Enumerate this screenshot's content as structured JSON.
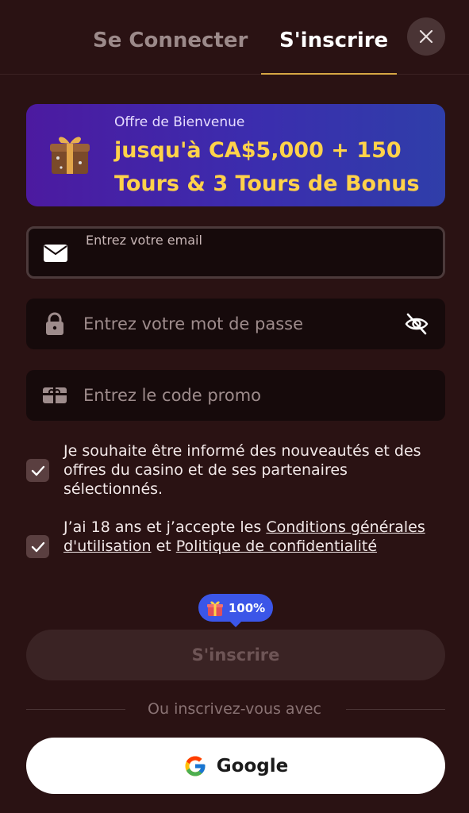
{
  "tabs": {
    "login": "Se Connecter",
    "signup": "S'inscrire"
  },
  "banner": {
    "subtitle": "Offre de Bienvenue",
    "title": "jusqu'à CA$5,000 + 150 Tours & 3 Tours de Bonus"
  },
  "form": {
    "email_label": "Entrez votre email",
    "email_value": "",
    "password_placeholder": "Entrez votre mot de passe",
    "promo_placeholder": "Entrez le code promo"
  },
  "consent": {
    "newsletter": "Je souhaite être informé des nouveautés et des offres du casino et de ses partenaires sélectionnés.",
    "age_prefix": "J’ai 18 ans et j’accepte les ",
    "terms_link": "Conditions générales d'utilisation",
    "conjunction": " et ",
    "privacy_link": "Politique de confidentialité",
    "newsletter_checked": true,
    "age_checked": true
  },
  "progress": {
    "label": "100%",
    "value": 1.0
  },
  "submit_label": "S'inscrire",
  "divider_text": "Ou inscrivez-vous avec",
  "google_label": "Google",
  "colors": {
    "background": "#2a1213",
    "accent_underline": "#d7a744",
    "banner_title": "#ffd24a",
    "bubble": "#3b56e8"
  },
  "icons": [
    "close-icon",
    "gift-icon",
    "mail-icon",
    "lock-icon",
    "eye-off-icon",
    "ticket-icon",
    "check-icon",
    "google-icon"
  ]
}
